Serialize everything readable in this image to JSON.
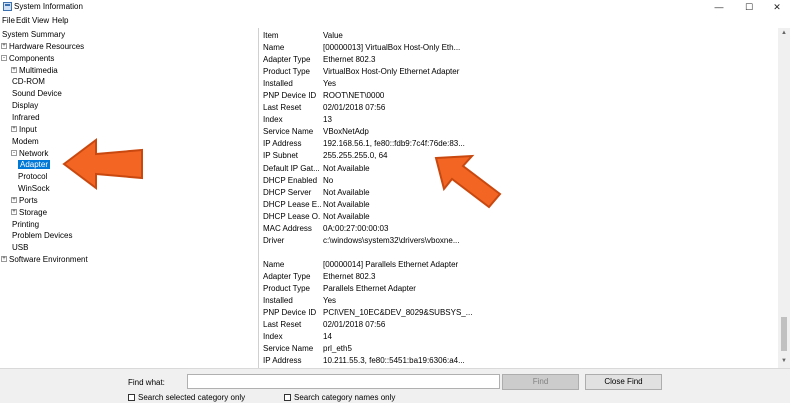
{
  "window": {
    "title": "System Information",
    "controls": [
      "—",
      "☐",
      "✕"
    ]
  },
  "menu": [
    "File",
    "Edit",
    "View",
    "Help"
  ],
  "tree": [
    {
      "label": "System Summary",
      "depth": 0,
      "expander": ""
    },
    {
      "label": "Hardware Resources",
      "depth": 0,
      "expander": "+"
    },
    {
      "label": "Components",
      "depth": 0,
      "expander": "-"
    },
    {
      "label": "Multimedia",
      "depth": 1,
      "expander": "+"
    },
    {
      "label": "CD-ROM",
      "depth": 1,
      "expander": ""
    },
    {
      "label": "Sound Device",
      "depth": 1,
      "expander": ""
    },
    {
      "label": "Display",
      "depth": 1,
      "expander": ""
    },
    {
      "label": "Infrared",
      "depth": 1,
      "expander": ""
    },
    {
      "label": "Input",
      "depth": 1,
      "expander": "+"
    },
    {
      "label": "Modem",
      "depth": 1,
      "expander": ""
    },
    {
      "label": "Network",
      "depth": 1,
      "expander": "-"
    },
    {
      "label": "Adapter",
      "depth": 2,
      "expander": "",
      "selected": true
    },
    {
      "label": "Protocol",
      "depth": 2,
      "expander": ""
    },
    {
      "label": "WinSock",
      "depth": 2,
      "expander": ""
    },
    {
      "label": "Ports",
      "depth": 1,
      "expander": "+"
    },
    {
      "label": "Storage",
      "depth": 1,
      "expander": "+"
    },
    {
      "label": "Printing",
      "depth": 1,
      "expander": ""
    },
    {
      "label": "Problem Devices",
      "depth": 1,
      "expander": ""
    },
    {
      "label": "USB",
      "depth": 1,
      "expander": ""
    },
    {
      "label": "Software Environment",
      "depth": 0,
      "expander": "+"
    }
  ],
  "details": {
    "header": {
      "item": "Item",
      "value": "Value"
    },
    "groups": [
      [
        {
          "item": "Name",
          "value": "[00000013] VirtualBox Host-Only Eth..."
        },
        {
          "item": "Adapter Type",
          "value": "Ethernet 802.3"
        },
        {
          "item": "Product Type",
          "value": "VirtualBox Host-Only Ethernet Adapter"
        },
        {
          "item": "Installed",
          "value": "Yes"
        },
        {
          "item": "PNP Device ID",
          "value": "ROOT\\NET\\0000"
        },
        {
          "item": "Last Reset",
          "value": "02/01/2018 07:56"
        },
        {
          "item": "Index",
          "value": "13"
        },
        {
          "item": "Service Name",
          "value": "VBoxNetAdp"
        },
        {
          "item": "IP Address",
          "value": "192.168.56.1, fe80::fdb9:7c4f:76de:83..."
        },
        {
          "item": "IP Subnet",
          "value": "255.255.255.0, 64"
        },
        {
          "item": "Default IP Gat...",
          "value": "Not Available"
        },
        {
          "item": "DHCP Enabled",
          "value": "No"
        },
        {
          "item": "DHCP Server",
          "value": "Not Available"
        },
        {
          "item": "DHCP Lease E...",
          "value": "Not Available"
        },
        {
          "item": "DHCP Lease O...",
          "value": "Not Available"
        },
        {
          "item": "MAC Address",
          "value": "0A:00:27:00:00:03"
        },
        {
          "item": "Driver",
          "value": "c:\\windows\\system32\\drivers\\vboxne..."
        }
      ],
      [
        {
          "item": "Name",
          "value": "[00000014] Parallels Ethernet Adapter"
        },
        {
          "item": "Adapter Type",
          "value": "Ethernet 802.3"
        },
        {
          "item": "Product Type",
          "value": "Parallels Ethernet Adapter"
        },
        {
          "item": "Installed",
          "value": "Yes"
        },
        {
          "item": "PNP Device ID",
          "value": "PCI\\VEN_10EC&DEV_8029&SUBSYS_..."
        },
        {
          "item": "Last Reset",
          "value": "02/01/2018 07:56"
        },
        {
          "item": "Index",
          "value": "14"
        },
        {
          "item": "Service Name",
          "value": "prl_eth5"
        },
        {
          "item": "IP Address",
          "value": "10.211.55.3, fe80::5451:ba19:6306:a4..."
        }
      ]
    ]
  },
  "find": {
    "label": "Find what:",
    "value": "",
    "find_button": "Find",
    "close_button": "Close Find",
    "check_selected": "Search selected category only",
    "check_names": "Search category names only"
  },
  "colors": {
    "selection": "#0078d7",
    "annotation_arrow": "#f26522"
  }
}
